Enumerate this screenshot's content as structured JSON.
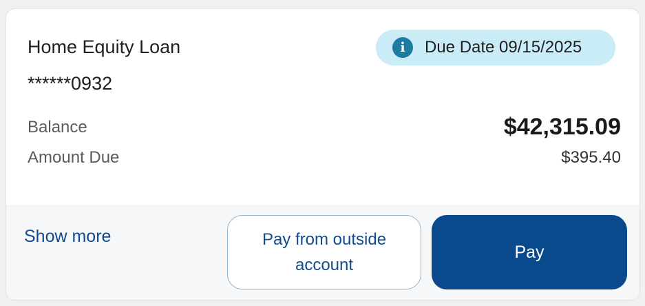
{
  "loan": {
    "name": "Home Equity Loan",
    "account_number": "******0932"
  },
  "due_badge": {
    "icon": "info-icon",
    "icon_glyph": "i",
    "text": "Due Date 09/15/2025",
    "background_color": "#c9ecf7",
    "icon_color": "#1d7aa0"
  },
  "details": {
    "balance_label": "Balance",
    "balance_value": "$42,315.09",
    "amount_due_label": "Amount Due",
    "amount_due_value": "$395.40"
  },
  "actions": {
    "show_more": "Show more",
    "pay_outside": "Pay from outside account",
    "pay": "Pay"
  },
  "colors": {
    "primary": "#0a4a8c",
    "link": "#134c8c"
  }
}
